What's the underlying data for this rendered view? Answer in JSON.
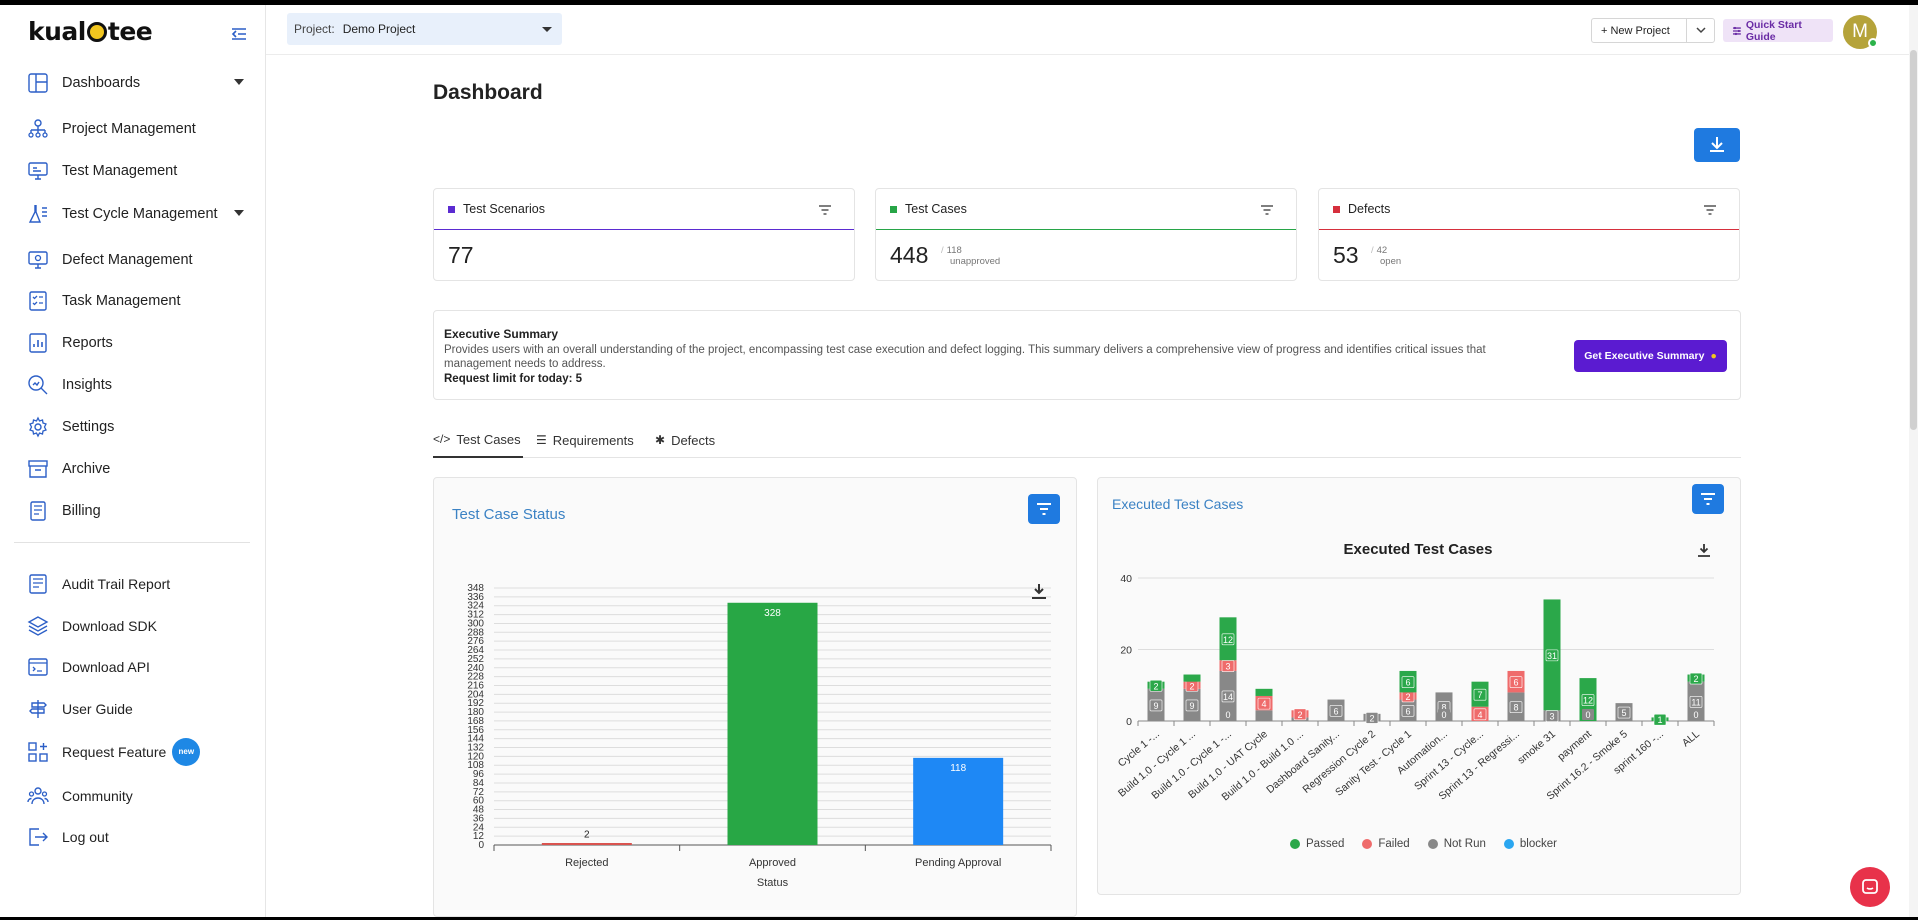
{
  "app": {
    "logo_text": "kualitee"
  },
  "sidebar": {
    "items": [
      {
        "label": "Dashboards",
        "icon": "dashboard-icon",
        "expandable": true
      },
      {
        "label": "Project Management",
        "icon": "org-chart-icon"
      },
      {
        "label": "Test Management",
        "icon": "test-monitor-icon"
      },
      {
        "label": "Test Cycle Management",
        "icon": "flask-icon",
        "expandable": true
      },
      {
        "label": "Defect Management",
        "icon": "bug-monitor-icon"
      },
      {
        "label": "Task Management",
        "icon": "checklist-icon"
      },
      {
        "label": "Reports",
        "icon": "report-icon"
      },
      {
        "label": "Insights",
        "icon": "magnifier-chart-icon"
      },
      {
        "label": "Settings",
        "icon": "gear-icon"
      },
      {
        "label": "Archive",
        "icon": "archive-icon"
      },
      {
        "label": "Billing",
        "icon": "billing-icon"
      }
    ],
    "secondary": [
      {
        "label": "Audit Trail Report",
        "icon": "audit-icon"
      },
      {
        "label": "Download SDK",
        "icon": "layers-icon"
      },
      {
        "label": "Download API",
        "icon": "api-icon"
      },
      {
        "label": "User Guide",
        "icon": "signpost-icon"
      },
      {
        "label": "Request Feature",
        "icon": "grid-plus-icon",
        "badge": "new"
      },
      {
        "label": "Community",
        "icon": "community-icon"
      },
      {
        "label": "Log out",
        "icon": "logout-icon"
      }
    ]
  },
  "topbar": {
    "project_label": "Project:",
    "project_value": "Demo Project",
    "new_project": "+  New Project",
    "quick_start": "Quick Start Guide",
    "avatar_initial": "M"
  },
  "dashboard": {
    "title": "Dashboard",
    "cards": [
      {
        "title": "Test Scenarios",
        "value": "77",
        "color": "#5b2bd1"
      },
      {
        "title": "Test Cases",
        "value": "448",
        "sub_value": "118",
        "sub_label": "unapproved",
        "color": "#27a547"
      },
      {
        "title": "Defects",
        "value": "53",
        "sub_value": "42",
        "sub_label": "open",
        "color": "#d62f3d"
      }
    ],
    "executive_summary": {
      "title": "Executive Summary",
      "description": "Provides users with an overall understanding of the project, encompassing test case execution and defect logging. This summary delivers a comprehensive view of progress and identifies critical issues that management needs to address.",
      "request_limit": "Request limit for today: 5",
      "button": "Get Executive Summary"
    },
    "tabs": [
      {
        "label": "Test Cases",
        "icon": "code-icon"
      },
      {
        "label": "Requirements",
        "icon": "list-icon"
      },
      {
        "label": "Defects",
        "icon": "bug-icon"
      }
    ]
  },
  "chart_data": [
    {
      "type": "bar",
      "title": "Test Case Status",
      "xlabel": "Status",
      "ylabel": "",
      "categories": [
        "Rejected",
        "Approved",
        "Pending Approval"
      ],
      "values": [
        2,
        328,
        118
      ],
      "colors": [
        "#d9534f",
        "#28a745",
        "#1e88f5"
      ],
      "ylim": [
        0,
        348
      ],
      "yticks": [
        0,
        12,
        24,
        36,
        48,
        60,
        72,
        84,
        96,
        108,
        120,
        132,
        144,
        156,
        168,
        180,
        192,
        204,
        216,
        228,
        240,
        252,
        264,
        276,
        288,
        300,
        312,
        324,
        336,
        348
      ]
    },
    {
      "type": "bar",
      "stacked": true,
      "title": "Executed Test Cases",
      "card_title": "Executed Test Cases",
      "categories": [
        "Cycle 1 -...",
        "Build 1.0 - Cycle 1 ...",
        "Build 1.0 - Cycle 1 -...",
        "Build 1.0 - UAT Cycle",
        "Build 1.0 - Build 1.0 ...",
        "Dashboard Sanity...",
        "Regression Cycle 2",
        "Sanity Test - Cycle 1",
        "Automation...",
        "Sprint 13 - Cycle...",
        "Sprint 13 - Regressi...",
        "smoke 31",
        "payment",
        "Sprint 16.2 - Smoke 5",
        "sprint 160 -...",
        "ALL"
      ],
      "series": [
        {
          "name": "Passed",
          "color": "#2ba84a",
          "values": [
            2,
            2,
            12,
            2,
            0,
            0,
            0,
            6,
            0,
            7,
            0,
            31,
            12,
            0,
            1,
            2
          ]
        },
        {
          "name": "Failed",
          "color": "#ef6b6b",
          "values": [
            0,
            2,
            3,
            4,
            2,
            0,
            0,
            2,
            0,
            4,
            6,
            0,
            0,
            0,
            0,
            0
          ]
        },
        {
          "name": "Not Run",
          "color": "#888888",
          "values": [
            9,
            9,
            14,
            3,
            1,
            6,
            2,
            6,
            8,
            0,
            8,
            3,
            0,
            5,
            0,
            11
          ]
        },
        {
          "name": "blocker",
          "color": "#2aa6f0",
          "values": [
            0,
            0,
            0,
            0,
            0,
            0,
            0,
            0,
            0,
            0,
            0,
            0,
            0,
            0,
            0,
            0
          ]
        }
      ],
      "labels": [
        [
          "2",
          "",
          "9"
        ],
        [
          "",
          "2",
          "9"
        ],
        [
          "12",
          "3",
          "14"
        ],
        [
          "",
          "4",
          ""
        ],
        [
          "",
          "2",
          ""
        ],
        [
          "",
          "",
          "6"
        ],
        [
          "",
          "",
          "2"
        ],
        [
          "6",
          "2",
          "6"
        ],
        [
          "",
          "",
          "8"
        ],
        [
          "7",
          "4",
          ""
        ],
        [
          "",
          "6",
          "8"
        ],
        [
          "31",
          "",
          "3"
        ],
        [
          "12",
          "",
          ""
        ],
        [
          "",
          "",
          "5"
        ],
        [
          "1",
          "",
          ""
        ],
        [
          "2",
          "",
          "11"
        ]
      ],
      "zero_labels": [
        "",
        "",
        "0",
        "",
        "",
        "",
        "",
        "",
        "0",
        "",
        "",
        "",
        "0",
        "",
        "",
        "0"
      ],
      "ylim": [
        0,
        40
      ],
      "yticks": [
        0,
        20,
        40
      ],
      "legend": "bottom"
    }
  ]
}
